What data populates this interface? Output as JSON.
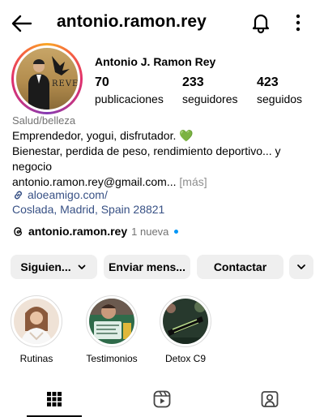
{
  "header": {
    "username": "antonio.ramon.rey",
    "back_icon": "arrow-left-icon",
    "bell_icon": "bell-icon",
    "more_icon": "more-vertical-icon"
  },
  "profile": {
    "display_name": "Antonio J. Ramon Rey",
    "avatar_brand_text": "REVE",
    "stats": [
      {
        "count": "70",
        "label": "publicaciones"
      },
      {
        "count": "233",
        "label": "seguidores"
      },
      {
        "count": "423",
        "label": "seguidos"
      }
    ],
    "category": "Salud/belleza",
    "bio_line1": "Emprendedor, yogui, disfrutador. 💚",
    "bio_line2": "Bienestar, perdida de peso, rendimiento deportivo... y negocio",
    "bio_line3": "antonio.ramon.rey@gmail.com...",
    "bio_more": "[más]",
    "link": "aloeamigo.com/",
    "location": "Coslada, Madrid, Spain 28821"
  },
  "threads": {
    "icon": "threads-icon",
    "username": "antonio.ramon.rey",
    "new_badge": "1 nueva"
  },
  "actions": {
    "following_label": "Siguien...",
    "message_label": "Enviar mens...",
    "contact_label": "Contactar",
    "expand_icon": "chevron-down-icon"
  },
  "highlights": [
    {
      "label": "Rutinas"
    },
    {
      "label": "Testimonios"
    },
    {
      "label": "Detox C9"
    }
  ],
  "tabs": {
    "grid_icon": "grid-icon",
    "reels_icon": "reels-icon",
    "tagged_icon": "tagged-icon"
  },
  "colors": {
    "link_blue": "#385185",
    "accent_blue": "#0095f6",
    "button_gray": "#efefef",
    "muted_text": "#737373"
  }
}
